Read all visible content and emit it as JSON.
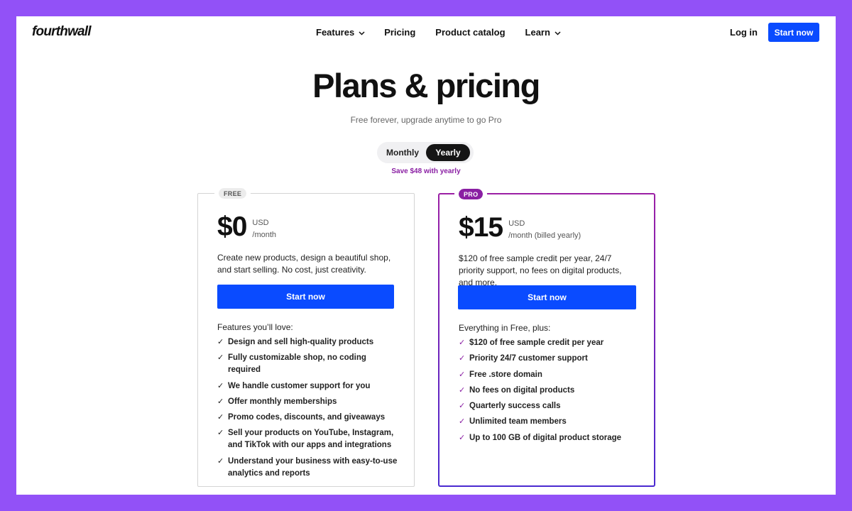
{
  "nav": {
    "logo": "fourthwall",
    "links": [
      {
        "label": "Features",
        "has_dropdown": true
      },
      {
        "label": "Pricing",
        "has_dropdown": false
      },
      {
        "label": "Product catalog",
        "has_dropdown": false
      },
      {
        "label": "Learn",
        "has_dropdown": true
      }
    ],
    "login": "Log in",
    "cta": "Start now"
  },
  "hero": {
    "title": "Plans & pricing",
    "subtitle": "Free forever, upgrade anytime to go Pro"
  },
  "billing_toggle": {
    "options": [
      "Monthly",
      "Yearly"
    ],
    "selected": "Yearly",
    "note": "Save $48 with yearly"
  },
  "plans": {
    "free": {
      "tag": "FREE",
      "price": "$0",
      "currency": "USD",
      "period": "/month",
      "description": "Create new products, design a beautiful shop, and start selling. No cost, just creativity.",
      "cta": "Start now",
      "features_heading": "Features you’ll love:",
      "features": [
        "Design and sell high-quality products",
        "Fully customizable shop, no coding required",
        "We handle customer support for you",
        "Offer monthly memberships",
        "Promo codes, discounts, and giveaways",
        "Sell your products on YouTube, Instagram, and TikTok with our apps and integrations",
        "Understand your business with easy-to-use analytics and reports"
      ]
    },
    "pro": {
      "tag": "PRO",
      "price": "$15",
      "currency": "USD",
      "period": "/month (billed yearly)",
      "description": "$120 of free sample credit per year, 24/7 priority support, no fees on digital products, and more.",
      "cta": "Start now",
      "features_heading": "Everything in Free, plus:",
      "features": [
        "$120 of free sample credit per year",
        "Priority 24/7 customer support",
        "Free .store domain",
        "No fees on digital products",
        "Quarterly success calls",
        "Unlimited team members",
        "Up to 100 GB of digital product storage"
      ]
    }
  },
  "colors": {
    "background": "#9251f7",
    "primary_button": "#0a4bff",
    "pro_accent": "#8a1fa3"
  },
  "icons": {
    "dropdown": "chevron-down-icon",
    "feature_bullet": "check-icon"
  }
}
